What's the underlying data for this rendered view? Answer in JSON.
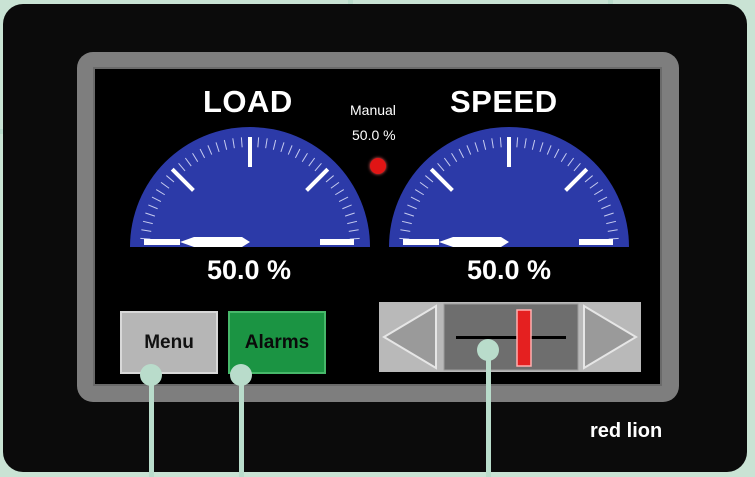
{
  "panel": {
    "load_title": "LOAD",
    "speed_title": "SPEED",
    "manual_label": "Manual",
    "manual_value": "50.0 %",
    "load_readout": "50.0 %",
    "speed_readout": "50.0 %"
  },
  "gauges": {
    "load": {
      "fraction": 0.5
    },
    "speed": {
      "fraction": 0.5
    }
  },
  "buttons": {
    "menu": "Menu",
    "alarms": "Alarms"
  },
  "slider": {
    "fraction": 0.5
  },
  "brand": {
    "logo": "red lion"
  },
  "colors": {
    "gauge": "#2c3aa8",
    "indicator": "#e01515",
    "alarms": "#1b9443",
    "callout": "#b9dccb"
  }
}
